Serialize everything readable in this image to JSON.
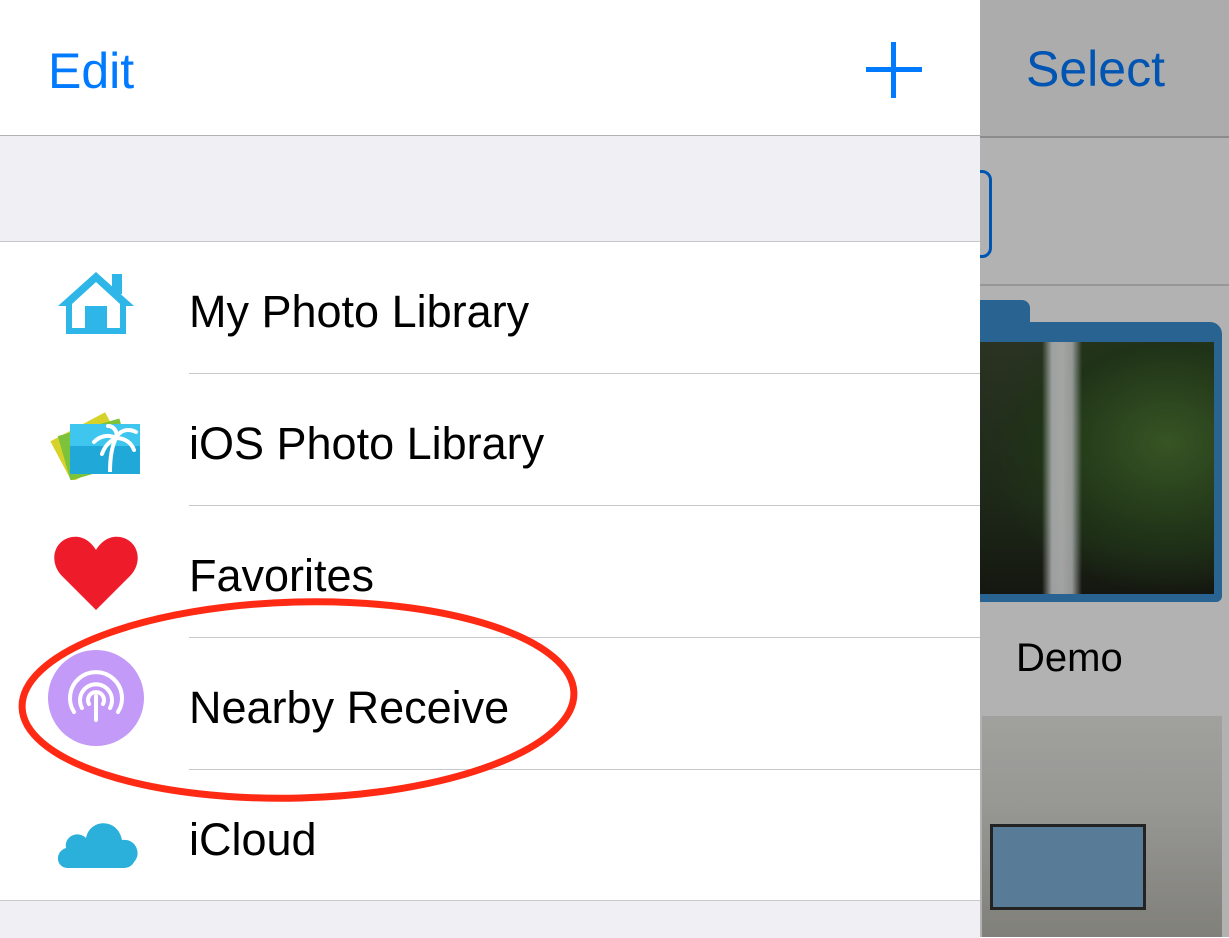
{
  "background": {
    "select_label": "Select",
    "album_name": "Demo"
  },
  "nav": {
    "edit_label": "Edit",
    "add_icon": "plus-icon"
  },
  "menu": {
    "items": [
      {
        "label": "My Photo Library",
        "icon": "house-icon",
        "color": "#2fb6e8"
      },
      {
        "label": "iOS Photo Library",
        "icon": "photos-app-icon",
        "color": "#29b6e0"
      },
      {
        "label": "Favorites",
        "icon": "heart-icon",
        "color": "#ee1c2a"
      },
      {
        "label": "Nearby Receive",
        "icon": "broadcast-icon",
        "color": "#c39af7"
      },
      {
        "label": "iCloud",
        "icon": "cloud-icon",
        "color": "#2bb0dc"
      }
    ]
  },
  "colors": {
    "accent": "#007aff",
    "annotation": "#ff2a14",
    "grouped_background": "#efeff4"
  }
}
